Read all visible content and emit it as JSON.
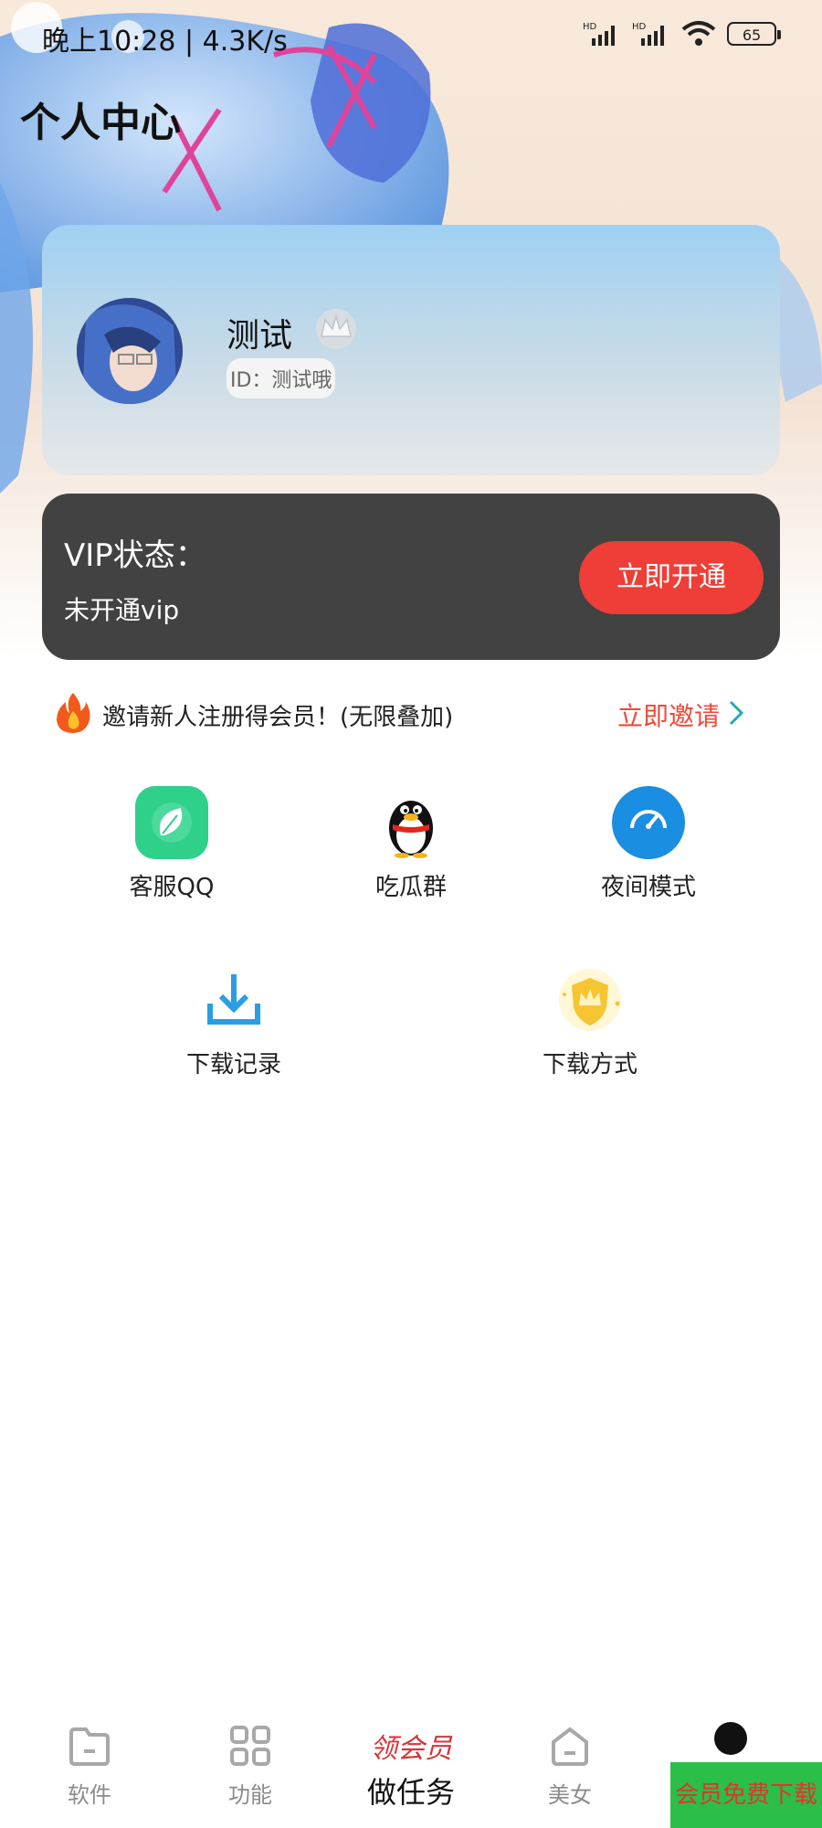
{
  "status_bar": {
    "time_and_speed": "晚上10:28 | 4.3K/s",
    "battery": "65"
  },
  "header": {
    "title": "个人中心"
  },
  "profile": {
    "name": "测试",
    "id_text": "ID：测试哦"
  },
  "vip": {
    "title": "VIP状态：",
    "status": "未开通vip",
    "button_label": "立即开通"
  },
  "invite": {
    "text": "邀请新人注册得会员！(无限叠加)",
    "link_label": "立即邀请"
  },
  "features": [
    {
      "label": "客服QQ",
      "icon": "leaf-icon"
    },
    {
      "label": "吃瓜群",
      "icon": "qq-penguin-icon"
    },
    {
      "label": "夜间模式",
      "icon": "speedometer-icon"
    },
    {
      "label": "下载记录",
      "icon": "download-icon"
    },
    {
      "label": "下载方式",
      "icon": "shield-crown-icon"
    }
  ],
  "tab_bar": {
    "tabs": [
      {
        "label": "软件",
        "icon": "folder-icon"
      },
      {
        "label": "功能",
        "icon": "grid-icon"
      },
      {
        "label": "美女",
        "icon": "home-icon"
      }
    ],
    "center_top": "领会员",
    "center_bottom": "做任务",
    "download_badge": "会员免费下载"
  },
  "colors": {
    "accent_red": "#ee3e37",
    "vip_card": "#424242",
    "badge_green": "#2bbf47"
  }
}
